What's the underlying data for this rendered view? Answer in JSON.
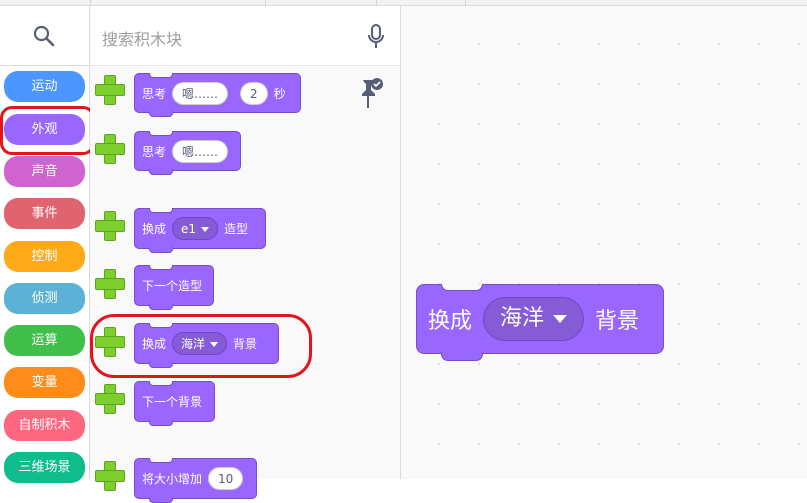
{
  "search": {
    "placeholder": "搜索积木块"
  },
  "categories": [
    {
      "label": "运动",
      "color": "#4c97ff"
    },
    {
      "label": "外观",
      "color": "#9966ff"
    },
    {
      "label": "声音",
      "color": "#cf63cf"
    },
    {
      "label": "事件",
      "color": "#e06470"
    },
    {
      "label": "控制",
      "color": "#ffab19"
    },
    {
      "label": "侦测",
      "color": "#5cb1d6"
    },
    {
      "label": "运算",
      "color": "#40bf4a"
    },
    {
      "label": "变量",
      "color": "#ff8c1a"
    },
    {
      "label": "自制积木",
      "color": "#ff6680"
    },
    {
      "label": "三维场景",
      "color": "#0fbd8c"
    }
  ],
  "palette_blocks": {
    "think_secs": {
      "verb": "思考",
      "text": "嗯……",
      "secs": "2",
      "unit": "秒"
    },
    "think": {
      "verb": "思考",
      "text": "嗯……"
    },
    "switch_costume": {
      "verb": "换成",
      "value": "e1",
      "suffix": "造型"
    },
    "next_costume": {
      "label": "下一个造型"
    },
    "switch_backdrop": {
      "verb": "换成",
      "value": "海洋",
      "suffix": "背景"
    },
    "next_backdrop": {
      "label": "下一个背景"
    },
    "size_change": {
      "label": "将大小增加",
      "value": "10"
    }
  },
  "workspace_block": {
    "verb": "换成",
    "value": "海洋",
    "suffix": "背景"
  },
  "colors": {
    "looks": "#9966ff",
    "highlight": "#e3151c",
    "add": "#7ccf2d"
  }
}
